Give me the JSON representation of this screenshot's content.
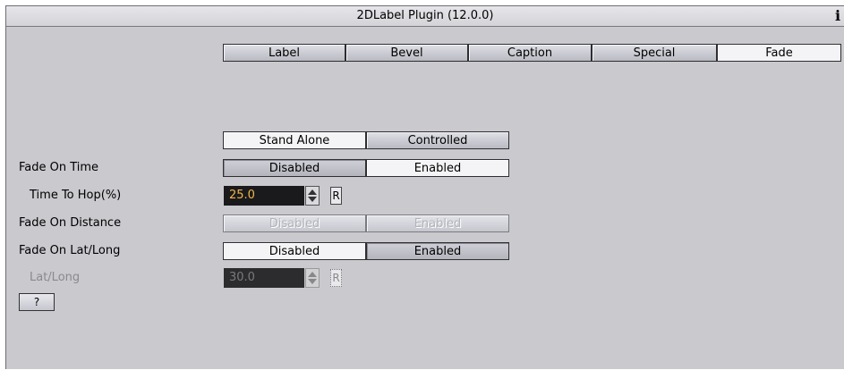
{
  "window": {
    "title": "2DLabel Plugin (12.0.0)",
    "info_icon": "info-icon"
  },
  "tabs": [
    {
      "label": "Label",
      "active": false
    },
    {
      "label": "Bevel",
      "active": false
    },
    {
      "label": "Caption",
      "active": false
    },
    {
      "label": "Special",
      "active": false
    },
    {
      "label": "Fade",
      "active": true
    }
  ],
  "mode": {
    "options": [
      "Stand Alone",
      "Controlled"
    ],
    "selected": "Stand Alone"
  },
  "fade_on_time": {
    "label": "Fade On Time",
    "options": [
      "Disabled",
      "Enabled"
    ],
    "selected": "Enabled"
  },
  "time_to_hop": {
    "label": "Time To Hop(%)",
    "value": "25.0",
    "reset_label": "R"
  },
  "fade_on_distance": {
    "label": "Fade On Distance",
    "options": [
      "Disabled",
      "Enabled"
    ],
    "enabled": false
  },
  "fade_on_latlong": {
    "label": "Fade On Lat/Long",
    "options": [
      "Disabled",
      "Enabled"
    ],
    "selected": "Disabled"
  },
  "lat_long": {
    "label": "Lat/Long",
    "value": "30.0",
    "reset_label": "R",
    "enabled": false
  },
  "help": {
    "label": "?"
  }
}
